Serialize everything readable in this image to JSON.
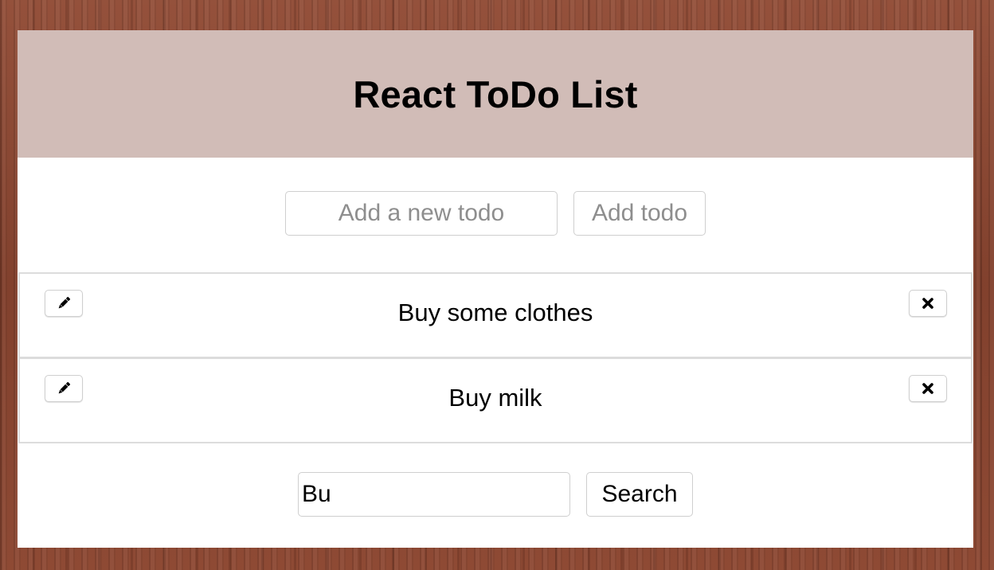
{
  "header": {
    "title": "React ToDo List"
  },
  "add_form": {
    "placeholder": "Add a new todo",
    "value": "",
    "button_label": "Add todo"
  },
  "todos": [
    {
      "text": "Buy some clothes",
      "edit_icon": "pencil-icon",
      "delete_icon": "close-icon"
    },
    {
      "text": "Buy milk",
      "edit_icon": "pencil-icon",
      "delete_icon": "close-icon"
    }
  ],
  "search_form": {
    "value": "Bu",
    "button_label": "Search"
  },
  "colors": {
    "header_background": "#d1bcb7",
    "panel_background": "#ffffff",
    "page_background": "#8a4a36",
    "border": "#cfcfcf",
    "placeholder_text": "#8e8e8e"
  }
}
